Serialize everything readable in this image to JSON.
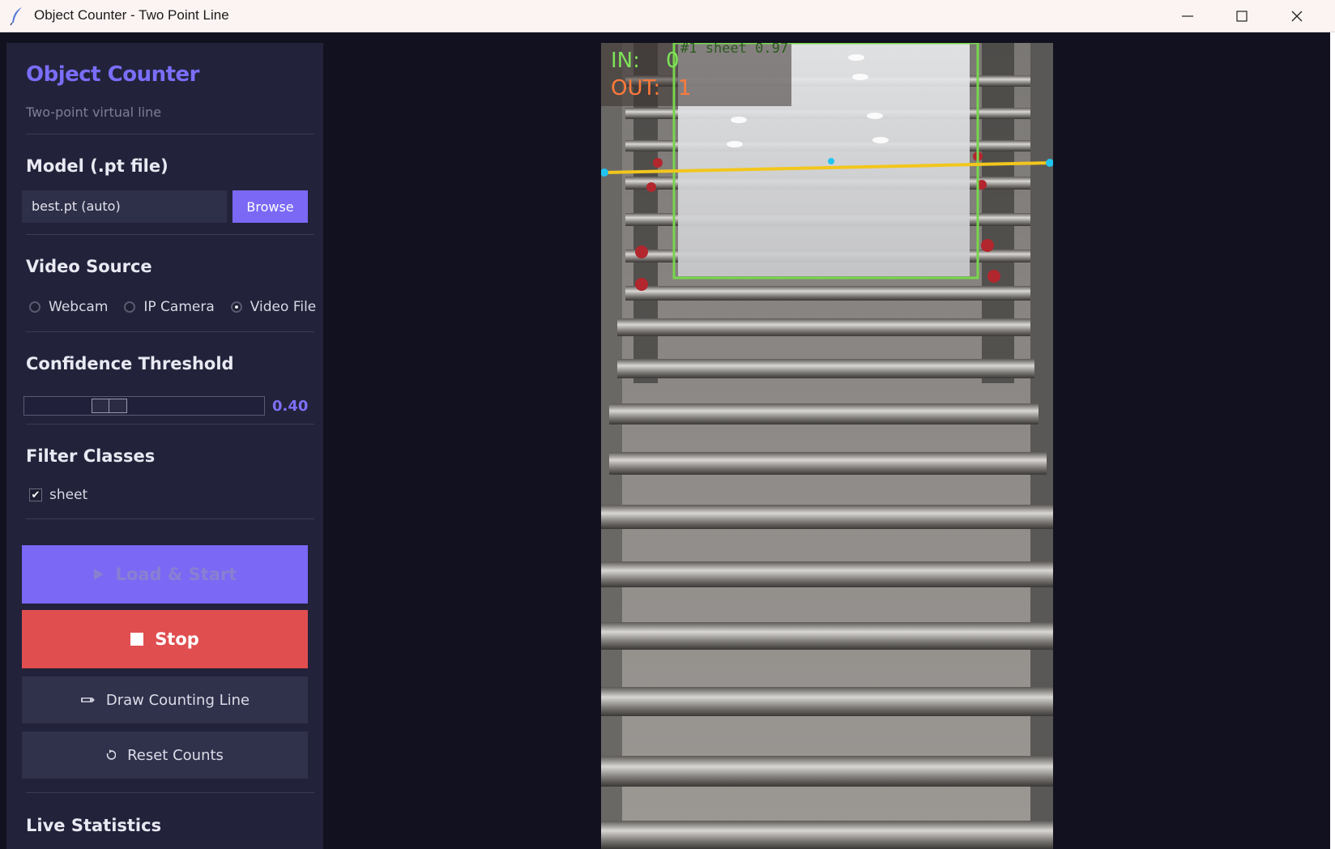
{
  "window": {
    "title": "Object Counter - Two Point Line"
  },
  "sidebar": {
    "title": "Object Counter",
    "subtitle": "Two-point virtual line",
    "model_section": {
      "heading": "Model (.pt file)",
      "input_value": "best.pt (auto)",
      "browse_label": "Browse"
    },
    "video_source": {
      "heading": "Video Source",
      "options": [
        "Webcam",
        "IP Camera",
        "Video File"
      ],
      "selected": "Video File"
    },
    "confidence": {
      "heading": "Confidence Threshold",
      "value": 0.4,
      "value_label": "0.40"
    },
    "filter_classes": {
      "heading": "Filter Classes",
      "classes": [
        {
          "label": "sheet",
          "checked": true
        }
      ]
    },
    "buttons": {
      "load_start": "Load & Start",
      "stop": "Stop",
      "draw_line": "Draw Counting Line",
      "reset_counts": "Reset Counts"
    },
    "live_stats_heading": "Live Statistics"
  },
  "video": {
    "count_in_label": "IN:",
    "count_in_value": "0",
    "count_out_label": "OUT:",
    "count_out_value": "1",
    "detection_label": "#1 sheet 0.97"
  },
  "colors": {
    "accent": "#7b68f5",
    "stop": "#e04e50",
    "sidebar_bg": "#22223a",
    "line": "#f2c61d",
    "box": "#78d64b"
  }
}
